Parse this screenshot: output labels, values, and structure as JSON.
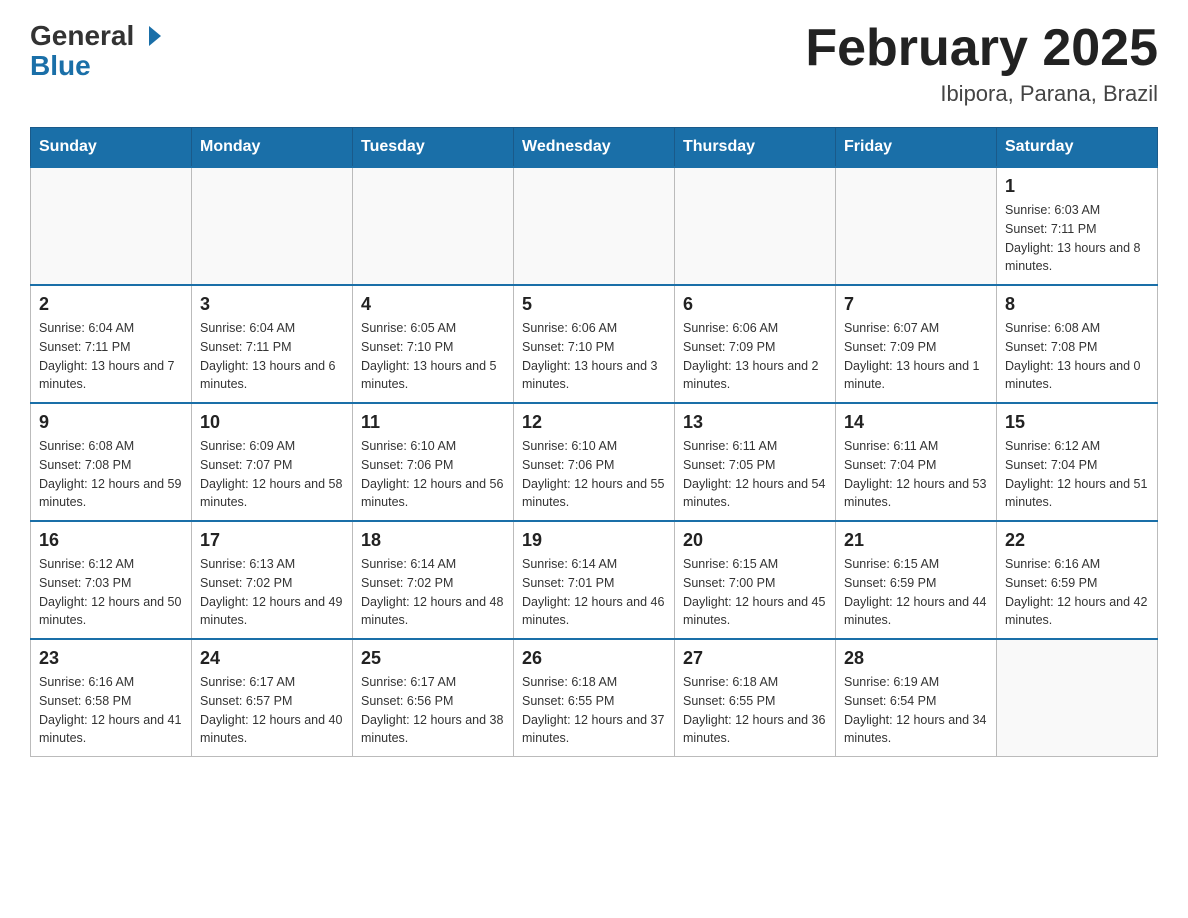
{
  "header": {
    "logo_general": "General",
    "logo_blue": "Blue",
    "month_title": "February 2025",
    "location": "Ibipora, Parana, Brazil"
  },
  "days_of_week": [
    "Sunday",
    "Monday",
    "Tuesday",
    "Wednesday",
    "Thursday",
    "Friday",
    "Saturday"
  ],
  "weeks": [
    [
      {
        "day": "",
        "info": ""
      },
      {
        "day": "",
        "info": ""
      },
      {
        "day": "",
        "info": ""
      },
      {
        "day": "",
        "info": ""
      },
      {
        "day": "",
        "info": ""
      },
      {
        "day": "",
        "info": ""
      },
      {
        "day": "1",
        "info": "Sunrise: 6:03 AM\nSunset: 7:11 PM\nDaylight: 13 hours and 8 minutes."
      }
    ],
    [
      {
        "day": "2",
        "info": "Sunrise: 6:04 AM\nSunset: 7:11 PM\nDaylight: 13 hours and 7 minutes."
      },
      {
        "day": "3",
        "info": "Sunrise: 6:04 AM\nSunset: 7:11 PM\nDaylight: 13 hours and 6 minutes."
      },
      {
        "day": "4",
        "info": "Sunrise: 6:05 AM\nSunset: 7:10 PM\nDaylight: 13 hours and 5 minutes."
      },
      {
        "day": "5",
        "info": "Sunrise: 6:06 AM\nSunset: 7:10 PM\nDaylight: 13 hours and 3 minutes."
      },
      {
        "day": "6",
        "info": "Sunrise: 6:06 AM\nSunset: 7:09 PM\nDaylight: 13 hours and 2 minutes."
      },
      {
        "day": "7",
        "info": "Sunrise: 6:07 AM\nSunset: 7:09 PM\nDaylight: 13 hours and 1 minute."
      },
      {
        "day": "8",
        "info": "Sunrise: 6:08 AM\nSunset: 7:08 PM\nDaylight: 13 hours and 0 minutes."
      }
    ],
    [
      {
        "day": "9",
        "info": "Sunrise: 6:08 AM\nSunset: 7:08 PM\nDaylight: 12 hours and 59 minutes."
      },
      {
        "day": "10",
        "info": "Sunrise: 6:09 AM\nSunset: 7:07 PM\nDaylight: 12 hours and 58 minutes."
      },
      {
        "day": "11",
        "info": "Sunrise: 6:10 AM\nSunset: 7:06 PM\nDaylight: 12 hours and 56 minutes."
      },
      {
        "day": "12",
        "info": "Sunrise: 6:10 AM\nSunset: 7:06 PM\nDaylight: 12 hours and 55 minutes."
      },
      {
        "day": "13",
        "info": "Sunrise: 6:11 AM\nSunset: 7:05 PM\nDaylight: 12 hours and 54 minutes."
      },
      {
        "day": "14",
        "info": "Sunrise: 6:11 AM\nSunset: 7:04 PM\nDaylight: 12 hours and 53 minutes."
      },
      {
        "day": "15",
        "info": "Sunrise: 6:12 AM\nSunset: 7:04 PM\nDaylight: 12 hours and 51 minutes."
      }
    ],
    [
      {
        "day": "16",
        "info": "Sunrise: 6:12 AM\nSunset: 7:03 PM\nDaylight: 12 hours and 50 minutes."
      },
      {
        "day": "17",
        "info": "Sunrise: 6:13 AM\nSunset: 7:02 PM\nDaylight: 12 hours and 49 minutes."
      },
      {
        "day": "18",
        "info": "Sunrise: 6:14 AM\nSunset: 7:02 PM\nDaylight: 12 hours and 48 minutes."
      },
      {
        "day": "19",
        "info": "Sunrise: 6:14 AM\nSunset: 7:01 PM\nDaylight: 12 hours and 46 minutes."
      },
      {
        "day": "20",
        "info": "Sunrise: 6:15 AM\nSunset: 7:00 PM\nDaylight: 12 hours and 45 minutes."
      },
      {
        "day": "21",
        "info": "Sunrise: 6:15 AM\nSunset: 6:59 PM\nDaylight: 12 hours and 44 minutes."
      },
      {
        "day": "22",
        "info": "Sunrise: 6:16 AM\nSunset: 6:59 PM\nDaylight: 12 hours and 42 minutes."
      }
    ],
    [
      {
        "day": "23",
        "info": "Sunrise: 6:16 AM\nSunset: 6:58 PM\nDaylight: 12 hours and 41 minutes."
      },
      {
        "day": "24",
        "info": "Sunrise: 6:17 AM\nSunset: 6:57 PM\nDaylight: 12 hours and 40 minutes."
      },
      {
        "day": "25",
        "info": "Sunrise: 6:17 AM\nSunset: 6:56 PM\nDaylight: 12 hours and 38 minutes."
      },
      {
        "day": "26",
        "info": "Sunrise: 6:18 AM\nSunset: 6:55 PM\nDaylight: 12 hours and 37 minutes."
      },
      {
        "day": "27",
        "info": "Sunrise: 6:18 AM\nSunset: 6:55 PM\nDaylight: 12 hours and 36 minutes."
      },
      {
        "day": "28",
        "info": "Sunrise: 6:19 AM\nSunset: 6:54 PM\nDaylight: 12 hours and 34 minutes."
      },
      {
        "day": "",
        "info": ""
      }
    ]
  ]
}
